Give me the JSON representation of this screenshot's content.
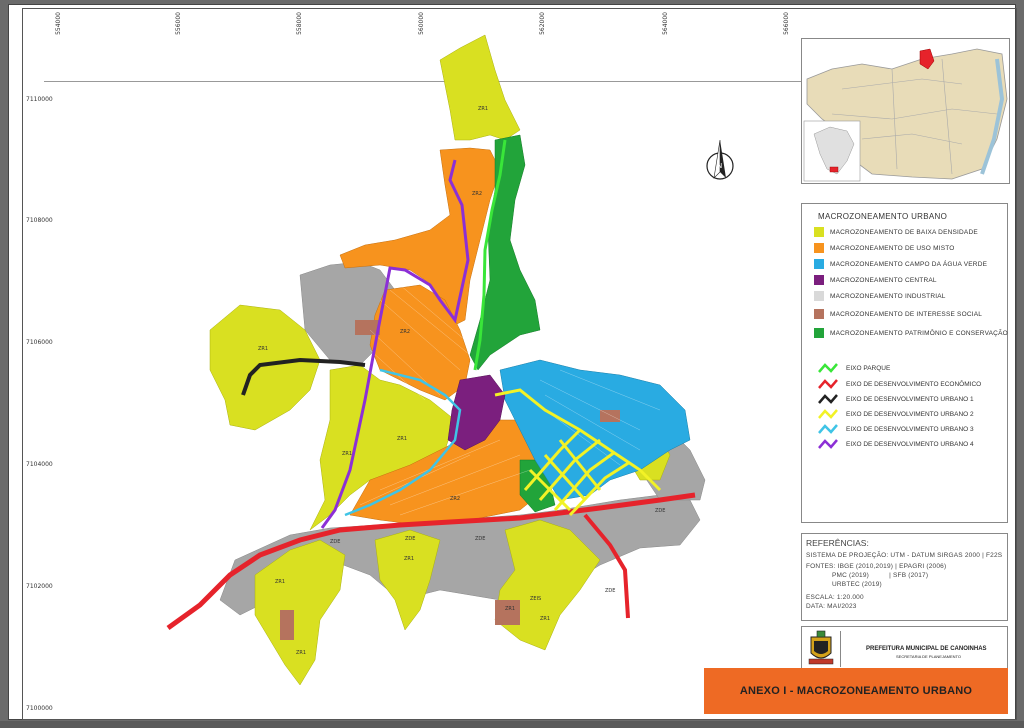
{
  "axes": {
    "x_ticks": [
      "554000",
      "556000",
      "558000",
      "560000",
      "562000",
      "564000",
      "566000"
    ],
    "y_ticks": [
      "7110000",
      "7108000",
      "7106000",
      "7104000",
      "7102000",
      "7100000"
    ]
  },
  "legend": {
    "title": "MACROZONEAMENTO URBANO",
    "zones": [
      {
        "label": "MACROZONEAMENTO DE BAIXA DENSIDADE",
        "color": "#d9e021"
      },
      {
        "label": "MACROZONEAMENTO DE USO MISTO",
        "color": "#f7931e"
      },
      {
        "label": "MACROZONEAMENTO CAMPO DA ÁGUA VERDE",
        "color": "#29abe2"
      },
      {
        "label": "MACROZONEAMENTO CENTRAL",
        "color": "#7b1f7e"
      },
      {
        "label": "MACROZONEAMENTO INDUSTRIAL",
        "color": "#d9d9d9"
      },
      {
        "label": "MACROZONEAMENTO DE INTERESSE SOCIAL",
        "color": "#b5735e"
      },
      {
        "label": "MACROZONEAMENTO PATRIMÔNIO E CONSERVAÇÃO",
        "color": "#22a43a"
      }
    ],
    "axes_lines": [
      {
        "label": "EIXO PARQUE",
        "color": "#39e639"
      },
      {
        "label": "EIXO DE DESENVOLVIMENTO ECONÔMICO",
        "color": "#e6232b"
      },
      {
        "label": "EIXO DE DESENVOLVIMENTO URBANO 1",
        "color": "#222222"
      },
      {
        "label": "EIXO DE DESENVOLVIMENTO URBANO 2",
        "color": "#f2f226"
      },
      {
        "label": "EIXO DE DESENVOLVIMENTO URBANO 3",
        "color": "#3fc4e6"
      },
      {
        "label": "EIXO DE DESENVOLVIMENTO URBANO 4",
        "color": "#8c2fd6"
      }
    ]
  },
  "references": {
    "title": "REFERÊNCIAS:",
    "lines": [
      "SISTEMA DE PROJEÇÃO: UTM - DATUM SIRGAS 2000 | F22S",
      "FONTES: IBGE (2010,2019) | EPAGRI (2006)",
      "PMC (2019)          | SFB (2017)",
      "URBTEC (2019)",
      "ESCALA: 1:20.000",
      "DATA: MAI/2023"
    ]
  },
  "footer": {
    "org": "PREFEITURA MUNICIPAL DE CANOINHAS",
    "dept": "SECRETARIA DE PLANEJAMENTO",
    "annex": "ANEXO I - MACROZONEAMENTO URBANO"
  },
  "map_labels": [
    "ZR1",
    "ZR2",
    "ZR1",
    "ZR1",
    "ZR1",
    "ZR1",
    "ZR1",
    "ZDE",
    "ZDE",
    "ZDE",
    "ZDE",
    "ZDE",
    "ZR2",
    "ZR2",
    "ZR1",
    "ZEIS",
    "ZR1",
    "ZR1"
  ]
}
